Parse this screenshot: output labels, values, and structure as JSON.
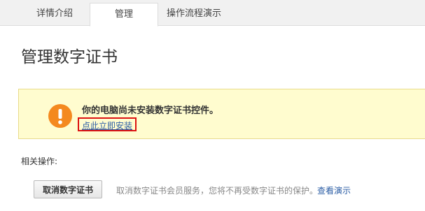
{
  "tabs": [
    {
      "label": "详情介绍",
      "active": false
    },
    {
      "label": "管理",
      "active": true
    },
    {
      "label": "操作流程演示",
      "active": false
    }
  ],
  "page_title": "管理数字证书",
  "notice": {
    "icon": "warning-icon",
    "message": "你的电脑尚未安装数字证书控件。",
    "install_link": "点此立即安装"
  },
  "related": {
    "label": "相关操作:",
    "cancel_button": "取消数字证书",
    "hint": "取消数字证书会员服务，您将不再受数字证书的保护。",
    "demo_link": "查看演示"
  },
  "colors": {
    "accent_link": "#2c5ea5",
    "warning": "#f4891f",
    "notice_bg": "#fffccf",
    "highlight_border": "#dd1111"
  }
}
